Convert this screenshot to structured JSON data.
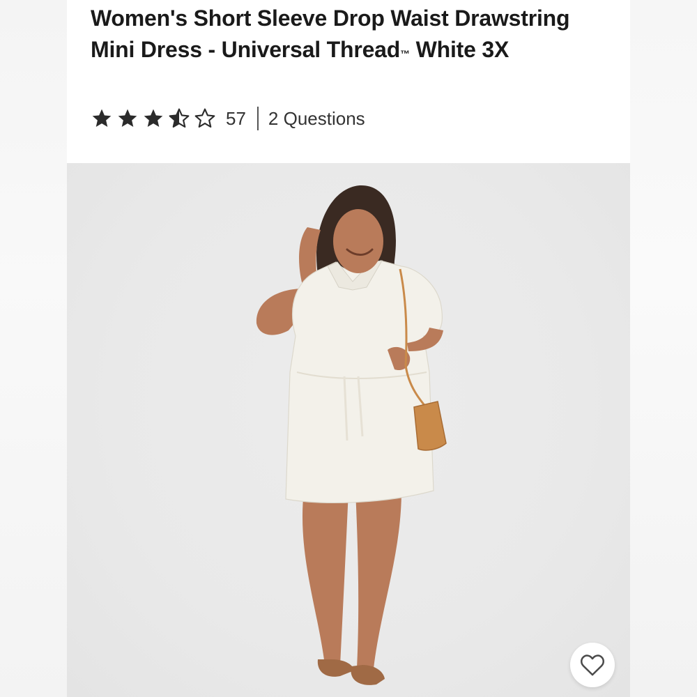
{
  "product": {
    "title_main": "Women's Short Sleeve Drop Waist Drawstring Mini Dress - Universal Thread",
    "title_tm": "™",
    "title_suffix": " White 3X",
    "rating_value": 3.5,
    "rating_max": 5,
    "review_count": "57",
    "questions_label": "2 Questions"
  },
  "colors": {
    "star": "#2b2b2b",
    "dress": "#f3f1ea",
    "bag": "#c98a4a",
    "skin": "#b97b5a"
  },
  "icons": {
    "star_full": "star-icon",
    "star_half": "star-half-icon",
    "star_empty": "star-outline-icon",
    "favorite": "heart-outline-icon"
  }
}
